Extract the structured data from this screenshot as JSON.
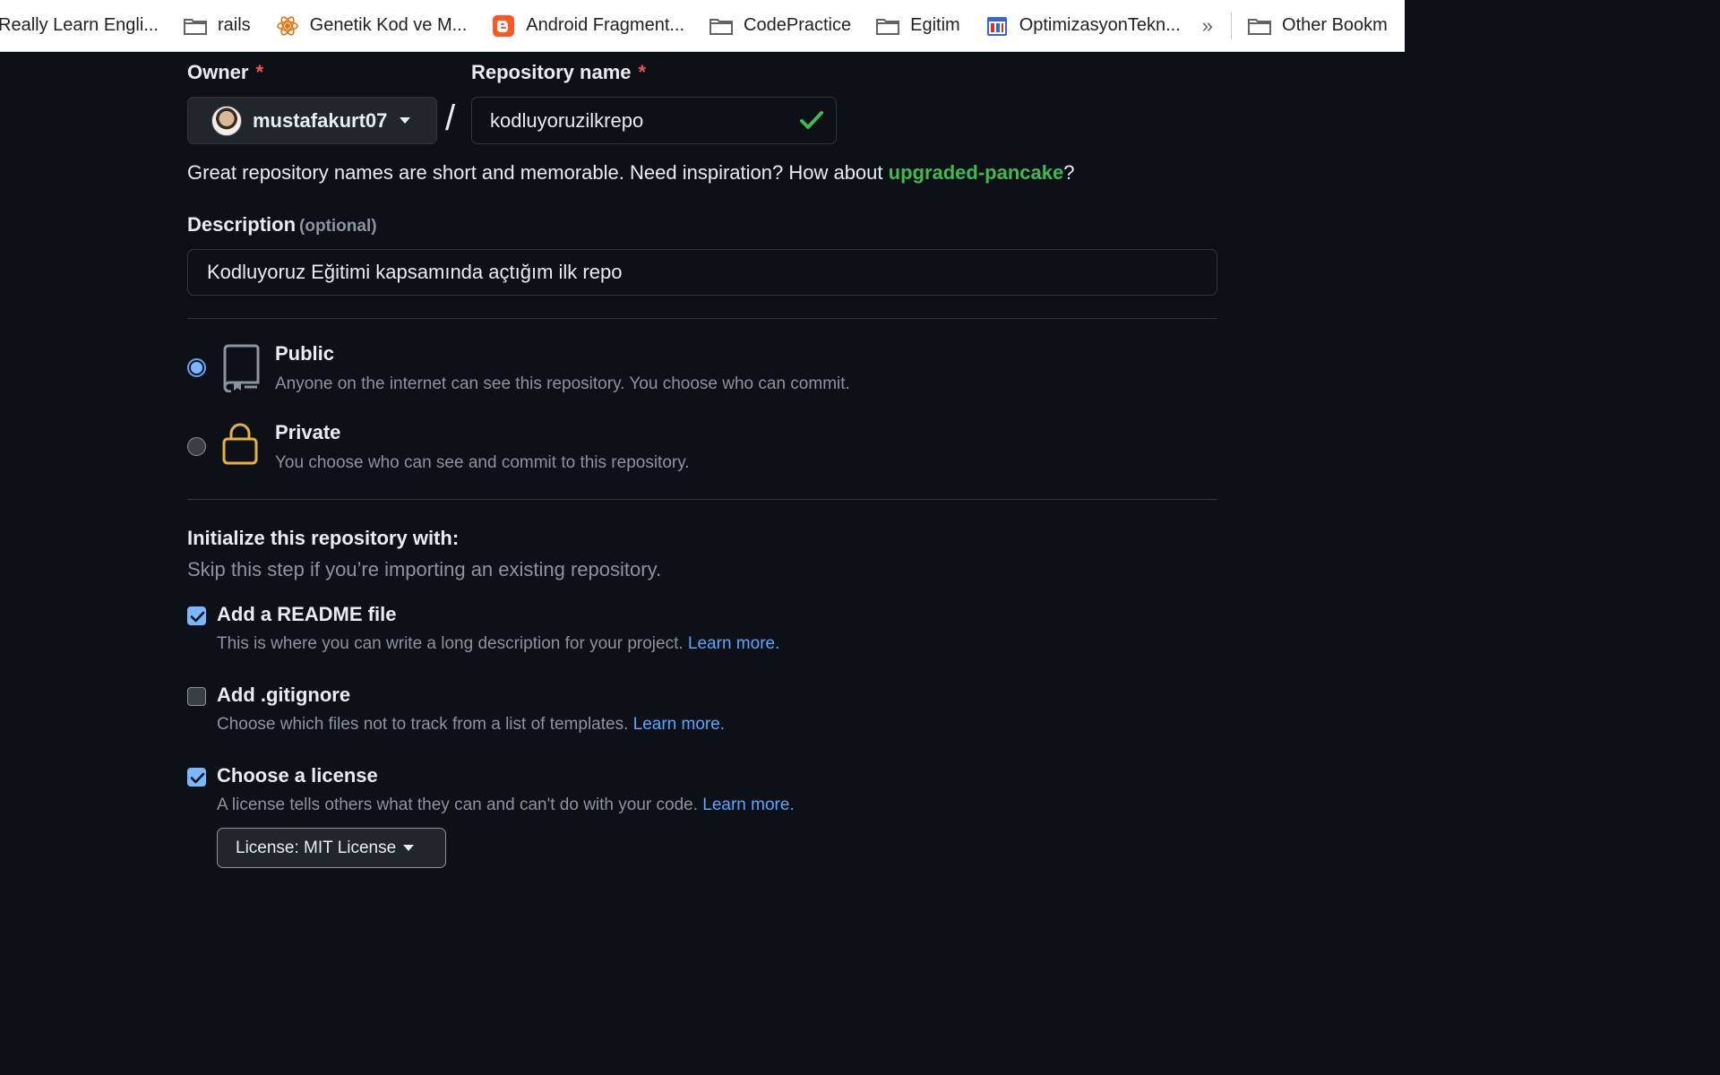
{
  "bookmarks": [
    {
      "label": "Really Learn Engli...",
      "icon": "none"
    },
    {
      "label": "rails",
      "icon": "folder-icon"
    },
    {
      "label": "Genetik Kod ve M...",
      "icon": "atom-icon"
    },
    {
      "label": "Android Fragment...",
      "icon": "blogger-icon"
    },
    {
      "label": "CodePractice",
      "icon": "folder-icon"
    },
    {
      "label": "Egitim",
      "icon": "folder-icon"
    },
    {
      "label": "OptimizasyonTekn...",
      "icon": "calendar-icon"
    }
  ],
  "bookmarks_more": "»",
  "bookmarks_other": "Other Bookm",
  "form": {
    "owner_label": "Owner",
    "repo_label": "Repository name",
    "required_mark": "*",
    "owner_value": "mustafakurt07",
    "separator": "/",
    "repo_value": "kodluyoruzilkrepo",
    "hint_prefix": "Great repository names are short and memorable. Need inspiration? How about ",
    "hint_suggestion": "upgraded-pancake",
    "hint_suffix": "?",
    "desc_label": "Description",
    "desc_optional": "(optional)",
    "desc_value": "Kodluyoruz Eğitimi kapsamında açtığım ilk repo"
  },
  "visibility": {
    "public_title": "Public",
    "public_desc": "Anyone on the internet can see this repository. You choose who can commit.",
    "private_title": "Private",
    "private_desc": "You choose who can see and commit to this repository.",
    "selected": "public"
  },
  "init": {
    "title": "Initialize this repository with:",
    "subtitle": "Skip this step if you’re importing an existing repository.",
    "readme_title": "Add a README file",
    "readme_desc": "This is where you can write a long description for your project.",
    "readme_checked": true,
    "gitignore_title": "Add .gitignore",
    "gitignore_desc": "Choose which files not to track from a list of templates.",
    "gitignore_checked": false,
    "license_title": "Choose a license",
    "license_desc": "A license tells others what they can and can't do with your code.",
    "license_checked": true,
    "learn_more": "Learn more.",
    "license_button": "License: MIT License"
  },
  "colors": {
    "background": "#0d1117",
    "accent": "#58a6ff",
    "success": "#3fb950",
    "required": "#f85149",
    "lock": "#e3b341"
  }
}
